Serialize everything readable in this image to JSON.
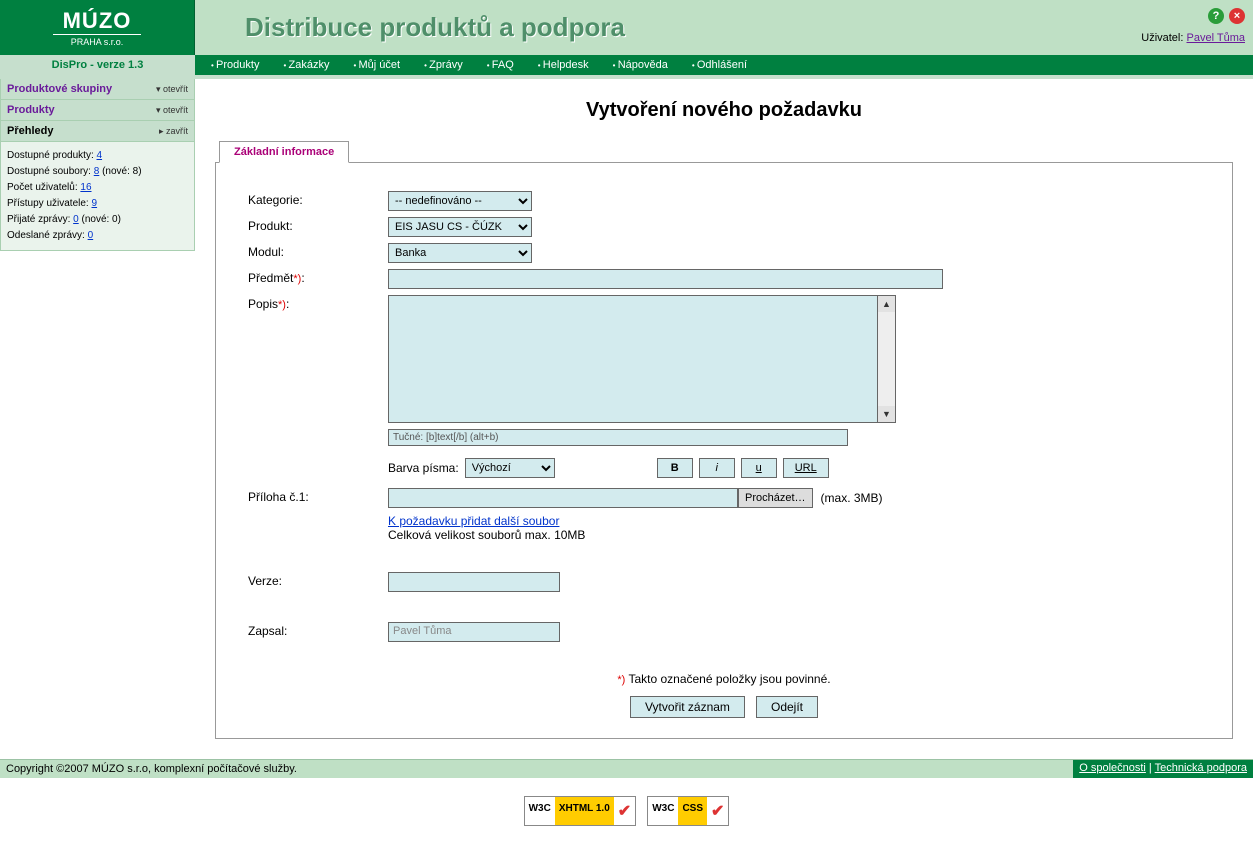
{
  "header": {
    "logo_main": "MÚZO",
    "logo_sub": "PRAHA s.r.o.",
    "app_title": "Distribuce produktů a podpora",
    "user_label": "Uživatel:",
    "user_name": "Pavel Tůma"
  },
  "version_bar": "DisPro - verze 1.3",
  "menu": [
    "Produkty",
    "Zakázky",
    "Můj účet",
    "Zprávy",
    "FAQ",
    "Helpdesk",
    "Nápověda",
    "Odhlášení"
  ],
  "sidebar": {
    "groups_head": "Produktové skupiny",
    "groups_toggle": "otevřít",
    "products_head": "Produkty",
    "products_toggle": "otevřít",
    "overview_head": "Přehledy",
    "overview_toggle": "zavřít",
    "stats": {
      "l1": "Dostupné produkty:",
      "v1": "4",
      "l2": "Dostupné soubory:",
      "v2": "8",
      "n2": "(nové: 8)",
      "l3": "Počet uživatelů:",
      "v3": "16",
      "l4": "Přístupy uživatele:",
      "v4": "9",
      "l5": "Přijaté zprávy:",
      "v5": "0",
      "n5": "(nové: 0)",
      "l6": "Odeslané zprávy:",
      "v6": "0"
    }
  },
  "page_title": "Vytvoření nového požadavku",
  "tab": "Základní informace",
  "form": {
    "cat_label": "Kategorie:",
    "cat_value": "-- nedefinováno --",
    "prod_label": "Produkt:",
    "prod_value": "EIS JASU CS - ČÚZK",
    "mod_label": "Modul:",
    "mod_value": "Banka",
    "subj_label": "Předmět",
    "desc_label": "Popis",
    "hint": "Tučné: [b]text[/b] (alt+b)",
    "color_label": "Barva písma:",
    "color_value": "Výchozí",
    "btn_b": "B",
    "btn_i": "i",
    "btn_u": "u",
    "btn_url": "URL",
    "attach_label": "Příloha č.1:",
    "browse": "Procházet…",
    "max_attach": "(max. 3MB)",
    "add_file": "K požadavku přidat další soubor",
    "total_size": "Celková velikost souborů max. 10MB",
    "version_label": "Verze:",
    "author_label": "Zapsal:",
    "author_value": "Pavel Tůma",
    "req_note": "Takto označené položky jsou povinné.",
    "btn_create": "Vytvořit záznam",
    "btn_leave": "Odejít"
  },
  "footer": {
    "copyright": "Copyright ©2007 MÚZO s.r.o, komplexní počítačové služby.",
    "about": "O společnosti",
    "support": "Technická podpora"
  },
  "validators": {
    "w3c": "W3C",
    "xhtml": "XHTML 1.0",
    "css": "CSS"
  }
}
